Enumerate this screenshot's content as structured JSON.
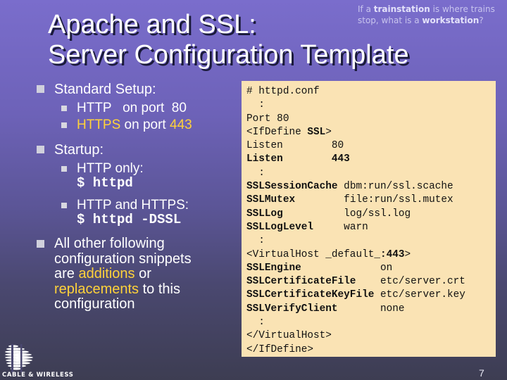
{
  "quip": {
    "line1_pre": "If a ",
    "line1_bold": "trainstation",
    "line1_post": " is where trains",
    "line2_pre": "stop, what is a ",
    "line2_bold": "workstation",
    "line2_post": "?"
  },
  "title": {
    "line1": "Apache and SSL:",
    "line2": "Server Configuration Template"
  },
  "bullets": {
    "standard_setup": "Standard Setup:",
    "http_port": "HTTP   on port  80",
    "https_label": "HTTPS",
    "on_port": " on port ",
    "https_port": "443",
    "startup": "Startup:",
    "http_only": "HTTP only:",
    "cmd_httpd": "$ httpd",
    "http_and_https": "HTTP and HTTPS:",
    "cmd_httpd_dssl": "$ httpd -DSSL",
    "other_1": "All other following",
    "other_2": "configuration snippets",
    "other_3a": "are ",
    "other_3b": "additions",
    "other_3c": " or",
    "other_4a": "replacements",
    "other_4b": " to this",
    "other_5": "configuration"
  },
  "code": {
    "l01": "# httpd.conf",
    "l02": "  :",
    "l03": "Port 80",
    "l04a": "<IfDefine ",
    "l04b": "SSL",
    "l04c": ">",
    "l05": "Listen        80",
    "l06": "Listen        443",
    "l07": "  :",
    "l08a": "SSLSessionCache",
    "l08b": " dbm:run/ssl.scache",
    "l09a": "SSLMutex",
    "l09b": "        file:run/ssl.mutex",
    "l10a": "SSLLog",
    "l10b": "          log/ssl.log",
    "l11a": "SSLLogLevel",
    "l11b": "     warn",
    "l12": "  :",
    "l13a": "<VirtualHost _default_",
    "l13b": ":443",
    "l13c": ">",
    "l14a": "SSLEngine",
    "l14b": "             on",
    "l15a": "SSLCertificateFile",
    "l15b": "    etc/server.crt",
    "l16a": "SSLCertificateKeyFile",
    "l16b": " etc/server.key",
    "l17a": "SSLVerifyClient",
    "l17b": "       none",
    "l18": "  :",
    "l19": "</VirtualHost>",
    "l20": "</IfDefine>"
  },
  "logo": {
    "text": "CABLE & WIRELESS"
  },
  "page_number": "7",
  "colors": {
    "highlight": "#ffd23a",
    "code_bg": "#fae3b4",
    "bg_top": "#7a6dcc",
    "bg_bottom": "#3d3d52"
  }
}
